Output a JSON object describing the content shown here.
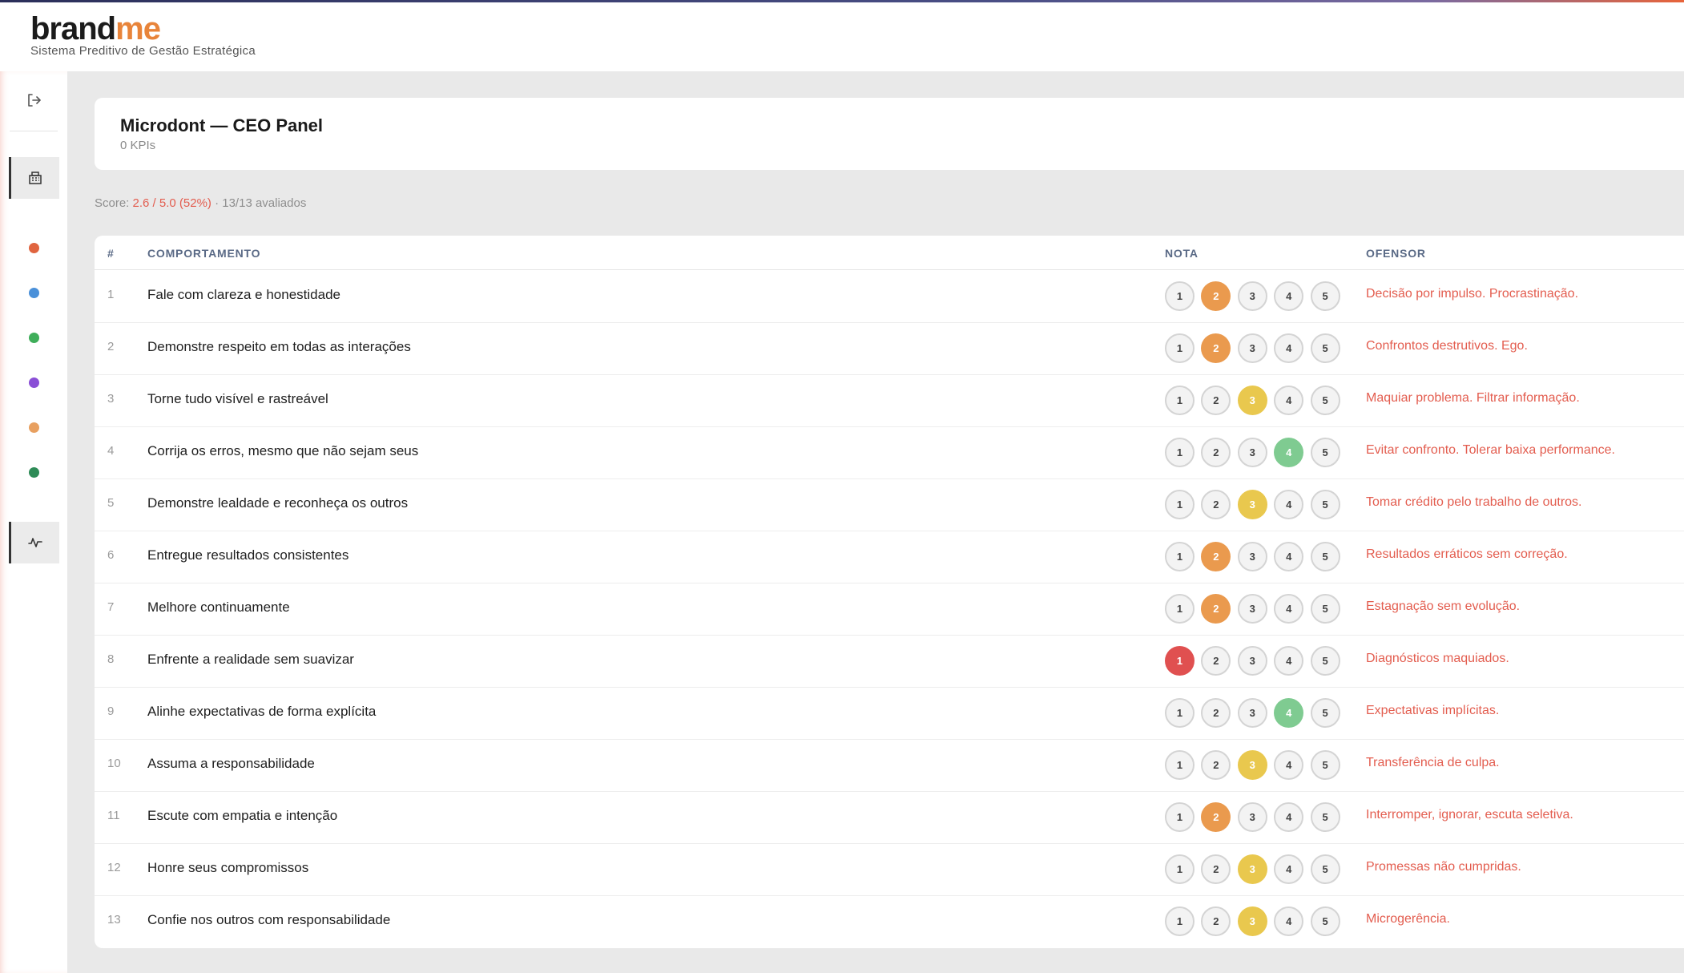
{
  "app": {
    "logo_brand": "brand",
    "logo_me": "me",
    "subtitle": "Sistema Preditivo de Gestão Estratégica"
  },
  "sidebar": {
    "icons": [
      "logout-icon",
      "building-icon",
      "activity-icon"
    ],
    "dots": [
      "#e0643f",
      "#4a90d9",
      "#3fae5a",
      "#8a4fd6",
      "#e8a060",
      "#2e8b57"
    ]
  },
  "panel": {
    "title": "Microdont — CEO Panel",
    "subtitle": "0 KPIs"
  },
  "score": {
    "label": "Score: ",
    "value": "2.6 / 5.0 (52%)",
    "evaluated": " · 13/13 avaliados"
  },
  "table": {
    "headers": {
      "num": "#",
      "behavior": "COMPORTAMENTO",
      "rating": "NOTA",
      "offender": "OFENSOR"
    },
    "rating_options": [
      "1",
      "2",
      "3",
      "4",
      "5"
    ],
    "rating_colors": {
      "1": "#e05050",
      "2": "#ea9a4e",
      "3": "#e9c84e",
      "4": "#7fcb91",
      "5": "#5aa7d9"
    },
    "rows": [
      {
        "num": "1",
        "behavior": "Fale com clareza e honestidade",
        "rating": 2,
        "offender": "Decisão por impulso. Procrastinação."
      },
      {
        "num": "2",
        "behavior": "Demonstre respeito em todas as interações",
        "rating": 2,
        "offender": "Confrontos destrutivos. Ego."
      },
      {
        "num": "3",
        "behavior": "Torne tudo visível e rastreável",
        "rating": 3,
        "offender": "Maquiar problema. Filtrar informação."
      },
      {
        "num": "4",
        "behavior": "Corrija os erros, mesmo que não sejam seus",
        "rating": 4,
        "offender": "Evitar confronto. Tolerar baixa performance."
      },
      {
        "num": "5",
        "behavior": "Demonstre lealdade e reconheça os outros",
        "rating": 3,
        "offender": "Tomar crédito pelo trabalho de outros."
      },
      {
        "num": "6",
        "behavior": "Entregue resultados consistentes",
        "rating": 2,
        "offender": "Resultados erráticos sem correção."
      },
      {
        "num": "7",
        "behavior": "Melhore continuamente",
        "rating": 2,
        "offender": "Estagnação sem evolução."
      },
      {
        "num": "8",
        "behavior": "Enfrente a realidade sem suavizar",
        "rating": 1,
        "offender": "Diagnósticos maquiados."
      },
      {
        "num": "9",
        "behavior": "Alinhe expectativas de forma explícita",
        "rating": 4,
        "offender": "Expectativas implícitas."
      },
      {
        "num": "10",
        "behavior": "Assuma a responsabilidade",
        "rating": 3,
        "offender": "Transferência de culpa."
      },
      {
        "num": "11",
        "behavior": "Escute com empatia e intenção",
        "rating": 2,
        "offender": "Interromper, ignorar, escuta seletiva."
      },
      {
        "num": "12",
        "behavior": "Honre seus compromissos",
        "rating": 3,
        "offender": "Promessas não cumpridas."
      },
      {
        "num": "13",
        "behavior": "Confie nos outros com responsabilidade",
        "rating": 3,
        "offender": "Microgerência."
      }
    ]
  }
}
